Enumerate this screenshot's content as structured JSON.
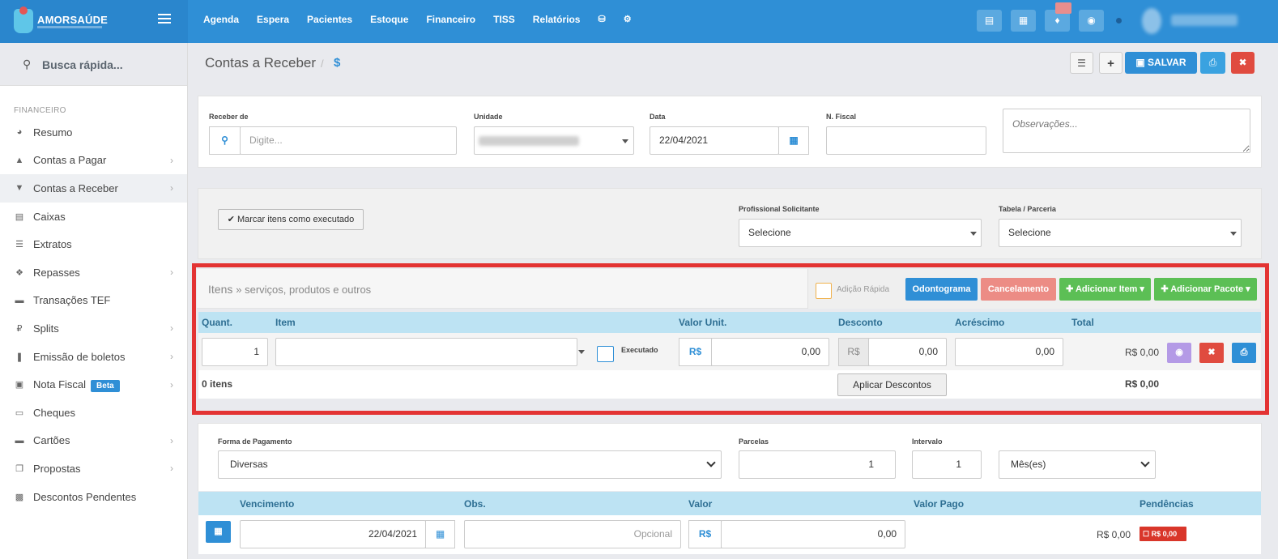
{
  "brand": {
    "name": "AMORSAÚDE"
  },
  "topnav": [
    "Agenda",
    "Espera",
    "Pacientes",
    "Estoque",
    "Financeiro",
    "TISS",
    "Relatórios"
  ],
  "topnav_icons": [
    "database-icon",
    "gear-icon"
  ],
  "top_actions": [
    "inbox-icon",
    "card-icon",
    "bell-icon",
    "chat-icon"
  ],
  "sidebar": {
    "search_placeholder": "Busca rápida...",
    "section": "FINANCEIRO",
    "items": [
      {
        "label": "Resumo",
        "icon": "pie-chart-icon",
        "chevron": false
      },
      {
        "label": "Contas a Pagar",
        "icon": "circle-up-icon",
        "chevron": true
      },
      {
        "label": "Contas a Receber",
        "icon": "circle-down-icon",
        "chevron": true,
        "active": true
      },
      {
        "label": "Caixas",
        "icon": "inbox-icon",
        "chevron": false
      },
      {
        "label": "Extratos",
        "icon": "list-icon",
        "chevron": false
      },
      {
        "label": "Repasses",
        "icon": "puzzle-icon",
        "chevron": true
      },
      {
        "label": "Transações TEF",
        "icon": "credit-card-icon",
        "chevron": false
      },
      {
        "label": "Splits",
        "icon": "ruble-icon",
        "chevron": true
      },
      {
        "label": "Emissão de boletos",
        "icon": "barcode-icon",
        "chevron": true
      },
      {
        "label": "Nota Fiscal",
        "icon": "file-icon",
        "chevron": true,
        "badge": "Beta"
      },
      {
        "label": "Cheques",
        "icon": "check-icon",
        "chevron": false
      },
      {
        "label": "Cartões",
        "icon": "credit-card-icon",
        "chevron": true
      },
      {
        "label": "Propostas",
        "icon": "copy-icon",
        "chevron": true
      },
      {
        "label": "Descontos Pendentes",
        "icon": "money-icon",
        "chevron": false
      }
    ]
  },
  "page": {
    "title": "Contas a Receber",
    "crumb_sep": "/",
    "crumb_symbol": "$",
    "save_label": "SALVAR"
  },
  "form": {
    "receber_de_label": "Receber de",
    "receber_de_placeholder": "Digite...",
    "unidade_label": "Unidade",
    "data_label": "Data",
    "data_value": "22/04/2021",
    "nfiscal_label": "N. Fiscal",
    "obs_placeholder": "Observações..."
  },
  "options": {
    "mark_executed": "Marcar itens como executado",
    "prof_label": "Profissional Solicitante",
    "prof_value": "Selecione",
    "tabela_label": "Tabela / Parceria",
    "tabela_value": "Selecione"
  },
  "items": {
    "title": "Itens",
    "subtitle": "» serviços, produtos e outros",
    "quick_add": "Adição Rápida",
    "odontograma": "Odontograma",
    "cancelamento": "Cancelamento",
    "add_item": "Adicionar Item",
    "add_pacote": "Adicionar Pacote",
    "columns": [
      "Quant.",
      "Item",
      "Valor Unit.",
      "Desconto",
      "Acréscimo",
      "Total"
    ],
    "row": {
      "quant": "1",
      "executado": "Executado",
      "currency": "R$",
      "valor_unit": "0,00",
      "desconto_currency": "R$",
      "desconto": "0,00",
      "acrescimo": "0,00",
      "total": "R$ 0,00"
    },
    "count": "0 itens",
    "apply_discounts": "Aplicar Descontos",
    "grand_total": "R$ 0,00"
  },
  "payment": {
    "forma_label": "Forma de Pagamento",
    "forma_value": "Diversas",
    "parcelas_label": "Parcelas",
    "parcelas_value": "1",
    "intervalo_label": "Intervalo",
    "intervalo_value": "1",
    "periodo_value": "Mês(es)",
    "columns": [
      "Vencimento",
      "Obs.",
      "Valor",
      "Valor Pago",
      "Pendências"
    ],
    "row": {
      "vencimento": "22/04/2021",
      "obs_placeholder": "Opcional",
      "currency": "R$",
      "valor": "0,00",
      "valor_pago": "R$ 0,00",
      "pendencia": "R$ 0,00"
    }
  }
}
